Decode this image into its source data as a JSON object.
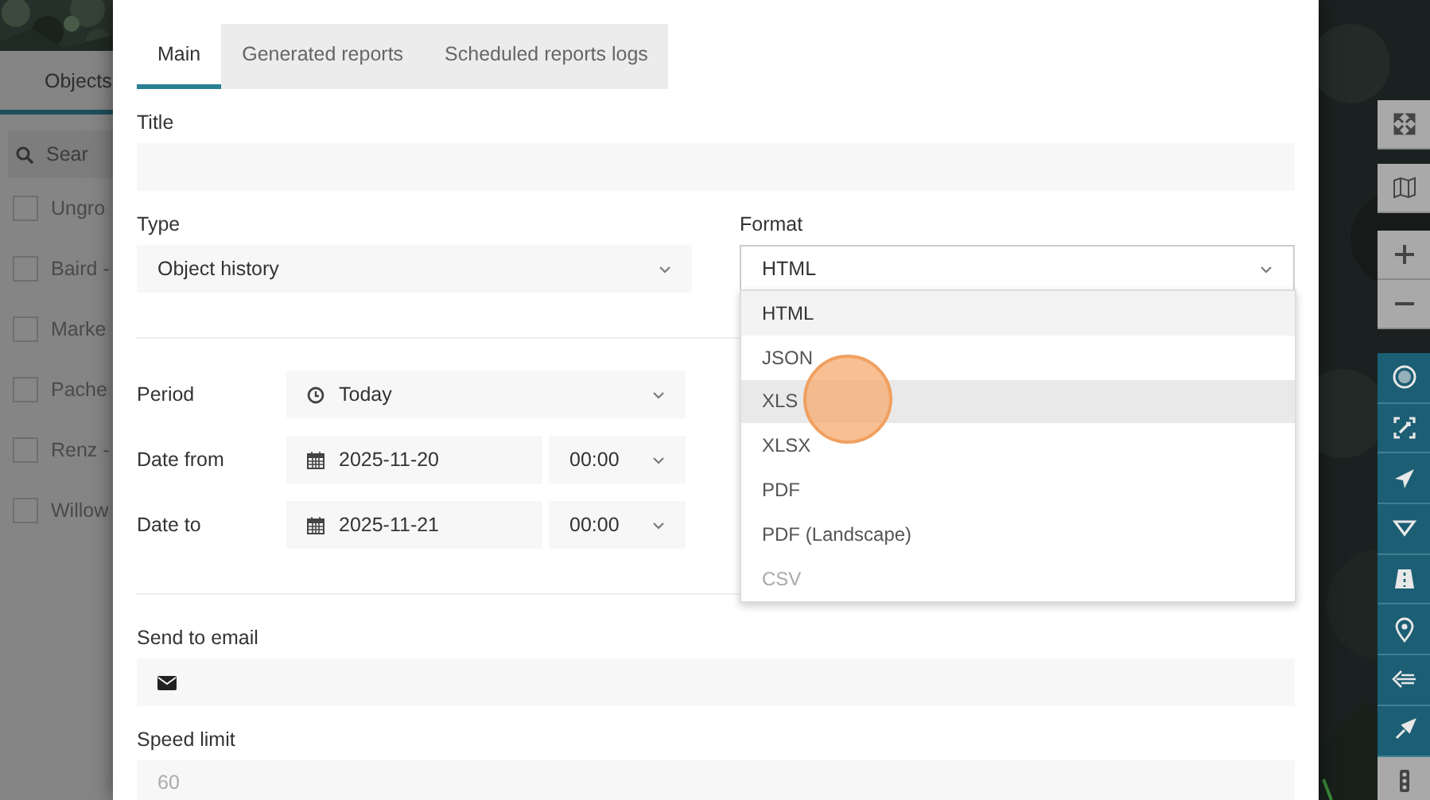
{
  "objects_panel": {
    "tab": "Objects",
    "search": {
      "placeholder": "Sear"
    },
    "items": [
      {
        "label": "Ungro",
        "checked": false
      },
      {
        "label": "Baird -",
        "checked": false
      },
      {
        "label": "Marke",
        "checked": false
      },
      {
        "label": "Pache",
        "checked": false
      },
      {
        "label": "Renz -",
        "checked": false
      },
      {
        "label": "Willow",
        "checked": false
      }
    ]
  },
  "tabs": [
    {
      "label": "Main",
      "selected": true
    },
    {
      "label": "Generated reports",
      "selected": false
    },
    {
      "label": "Scheduled reports logs",
      "selected": false
    }
  ],
  "form": {
    "title": {
      "label": "Title"
    },
    "type": {
      "label": "Type",
      "value": "Object history"
    },
    "format": {
      "label": "Format",
      "value": "HTML",
      "expanded": true,
      "options": [
        {
          "label": "HTML",
          "selected": true,
          "hovered": false,
          "disabled": false
        },
        {
          "label": "JSON",
          "selected": false,
          "hovered": false,
          "disabled": false
        },
        {
          "label": "XLS",
          "selected": false,
          "hovered": true,
          "disabled": false
        },
        {
          "label": "XLSX",
          "selected": false,
          "hovered": false,
          "disabled": false
        },
        {
          "label": "PDF",
          "selected": false,
          "hovered": false,
          "disabled": false
        },
        {
          "label": "PDF (Landscape)",
          "selected": false,
          "hovered": false,
          "disabled": false
        },
        {
          "label": "CSV",
          "selected": false,
          "hovered": false,
          "disabled": true
        }
      ]
    },
    "period": {
      "label": "Period",
      "value": "Today"
    },
    "date_from": {
      "label": "Date from",
      "date": "2025-11-20",
      "time": "00:00"
    },
    "date_to": {
      "label": "Date to",
      "date": "2025-11-21",
      "time": "00:00"
    },
    "email": {
      "label": "Send to email"
    },
    "speed_limit": {
      "label": "Speed limit",
      "placeholder": "60"
    }
  }
}
